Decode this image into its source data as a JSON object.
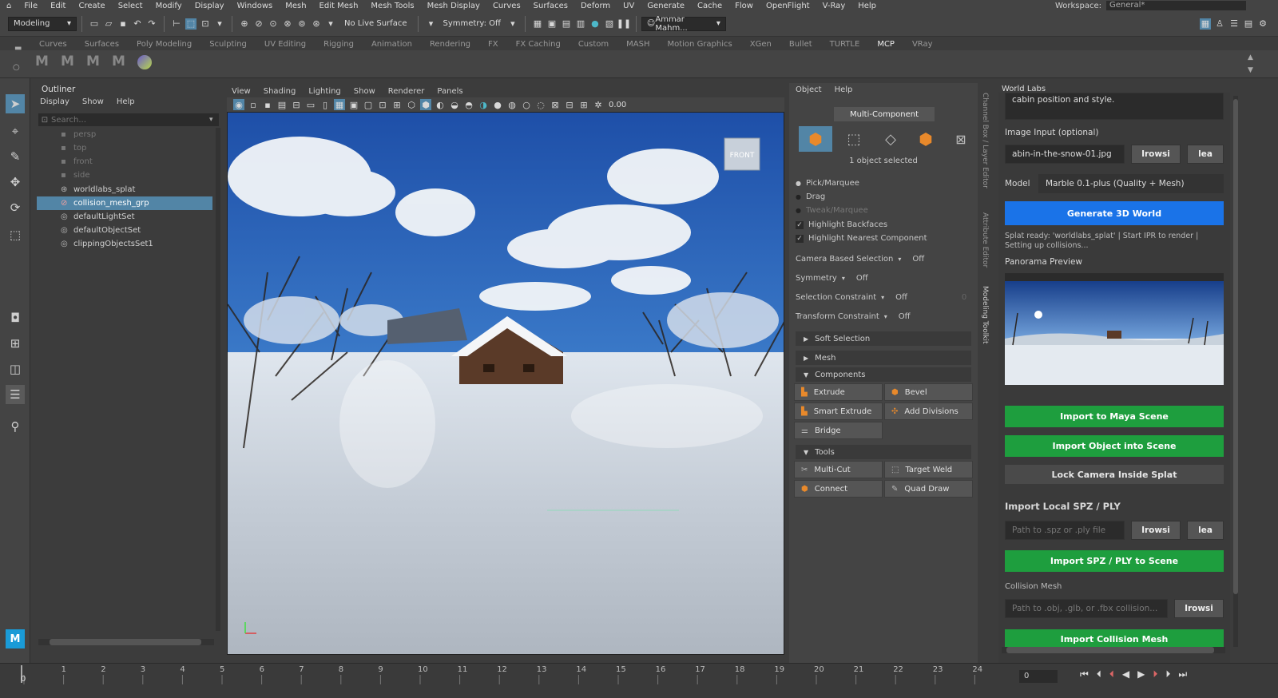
{
  "menubar": {
    "items": [
      "File",
      "Edit",
      "Create",
      "Select",
      "Modify",
      "Display",
      "Windows",
      "Mesh",
      "Edit Mesh",
      "Mesh Tools",
      "Mesh Display",
      "Curves",
      "Surfaces",
      "Deform",
      "UV",
      "Generate",
      "Cache",
      "Flow",
      "OpenFlight",
      "V-Ray",
      "Help"
    ],
    "workspace_label": "Workspace:",
    "workspace_value": "General*"
  },
  "statusline": {
    "mode": "Modeling",
    "live_surface": "No Live Surface",
    "symmetry": "Symmetry: Off",
    "user": "Ammar Mahm..."
  },
  "shelf": {
    "tabs": [
      "Curves",
      "Surfaces",
      "Poly Modeling",
      "Sculpting",
      "UV Editing",
      "Rigging",
      "Animation",
      "Rendering",
      "FX",
      "FX Caching",
      "Custom",
      "MASH",
      "Motion Graphics",
      "XGen",
      "Bullet",
      "TURTLE",
      "MCP",
      "VRay"
    ],
    "active_tab": "MCP",
    "icons": [
      "M",
      "M",
      "M",
      "M"
    ]
  },
  "outliner": {
    "title": "Outliner",
    "menu": [
      "Display",
      "Show",
      "Help"
    ],
    "search_placeholder": "Search...",
    "items": [
      {
        "label": "persp",
        "dim": true
      },
      {
        "label": "top",
        "dim": true
      },
      {
        "label": "front",
        "dim": true
      },
      {
        "label": "side",
        "dim": true
      },
      {
        "label": "worldlabs_splat",
        "dim": false
      },
      {
        "label": "collision_mesh_grp",
        "dim": false,
        "selected": true
      },
      {
        "label": "defaultLightSet",
        "dim": false
      },
      {
        "label": "defaultObjectSet",
        "dim": false
      },
      {
        "label": "clippingObjectsSet1",
        "dim": false
      }
    ]
  },
  "viewport": {
    "menu": [
      "View",
      "Shading",
      "Lighting",
      "Show",
      "Renderer",
      "Panels"
    ],
    "exposure": "0.00",
    "cube_label": "FRONT"
  },
  "toolkit": {
    "menu": [
      "Object",
      "Help"
    ],
    "mode_button": "Multi-Component",
    "selected_info": "1 object selected",
    "pick_marquee": "Pick/Marquee",
    "drag": "Drag",
    "tweak_marquee": "Tweak/Marquee",
    "highlight_backfaces": "Highlight Backfaces",
    "highlight_nearest": "Highlight Nearest Component",
    "camera_based_selection": "Camera Based Selection",
    "camera_based_value": "Off",
    "symmetry": "Symmetry",
    "symmetry_value": "Off",
    "selection_constraint": "Selection Constraint",
    "selection_constraint_value": "Off",
    "selection_constraint_num": "0",
    "transform_constraint": "Transform Constraint",
    "transform_constraint_value": "Off",
    "soft_selection": "Soft Selection",
    "mesh": "Mesh",
    "components": "Components",
    "extrude": "Extrude",
    "bevel": "Bevel",
    "smart_extrude": "Smart Extrude",
    "add_divisions": "Add Divisions",
    "bridge": "Bridge",
    "tools": "Tools",
    "multi_cut": "Multi-Cut",
    "target_weld": "Target Weld",
    "connect": "Connect",
    "quad_draw": "Quad Draw",
    "side_tabs": [
      "Channel Box / Layer Editor",
      "Attribute Editor",
      "Modeling Toolkit"
    ]
  },
  "worldlabs": {
    "title": "World Labs",
    "prompt_tail": "cabin position and style.",
    "image_input_label": "Image Input (optional)",
    "image_input_value": "abin-in-the-snow-01.jpg",
    "browse": "Irowsi",
    "clear": "lea",
    "model_label": "Model",
    "model_value": "Marble 0.1-plus (Quality + Mesh)",
    "generate_button": "Generate 3D World",
    "status_line1": "Splat ready: 'worldlabs_splat' | Start IPR to render |",
    "status_line2": "Setting up collisions...",
    "panorama_label": "Panorama Preview",
    "import_maya": "Import to Maya Scene",
    "import_object": "Import Object into Scene",
    "lock_camera": "Lock Camera Inside Splat",
    "import_local_heading": "Import Local SPZ / PLY",
    "spz_placeholder": "Path to .spz or .ply file",
    "import_spz": "Import SPZ / PLY to Scene",
    "collision_label": "Collision Mesh",
    "collision_placeholder": "Path to .obj, .glb, or .fbx collision...",
    "import_collision": "Import Collision Mesh"
  },
  "timeline": {
    "ticks": [
      "0",
      "1",
      "2",
      "3",
      "4",
      "5",
      "6",
      "7",
      "8",
      "9",
      "10",
      "11",
      "12",
      "13",
      "14",
      "15",
      "16",
      "17",
      "18",
      "19",
      "20",
      "21",
      "22",
      "23",
      "24"
    ],
    "start_value": "0",
    "current_frame": "0"
  },
  "colors": {
    "panel_bg": "#444444",
    "selection_blue": "#5285a6",
    "generate_blue": "#1a73e8",
    "import_green": "#1e9e3e",
    "mesh_orange": "#e8892b"
  }
}
